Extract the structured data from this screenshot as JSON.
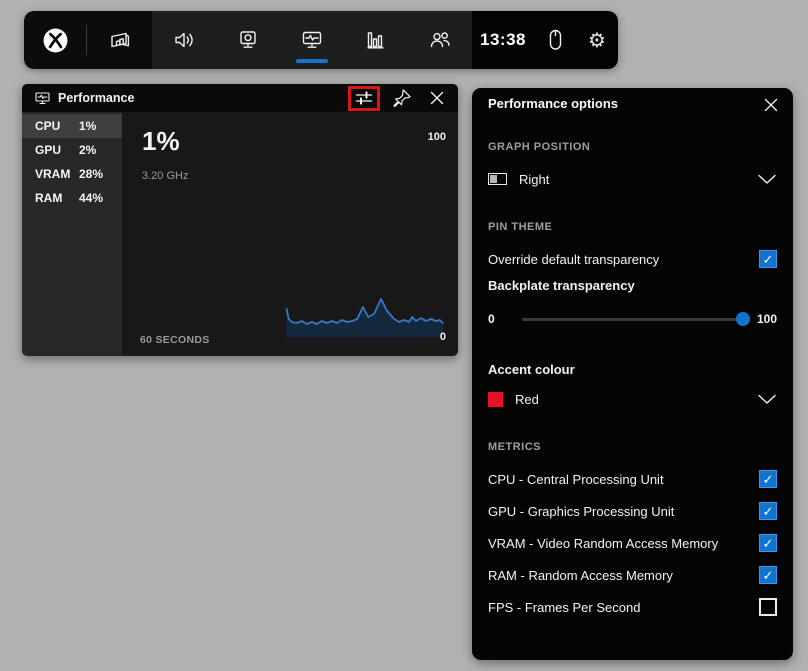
{
  "toolbar": {
    "time": "13:38",
    "active_tab": "performance",
    "icons": [
      "xbox-logo",
      "widget-menu",
      "audio",
      "capture",
      "performance",
      "resources",
      "social",
      "mouse",
      "settings"
    ]
  },
  "performance_widget": {
    "title": "Performance",
    "header_icons": [
      "performance-mini",
      "options-sliders",
      "pin",
      "close"
    ],
    "stats": [
      {
        "label": "CPU",
        "value": "1%",
        "selected": true
      },
      {
        "label": "GPU",
        "value": "2%",
        "selected": false
      },
      {
        "label": "VRAM",
        "value": "28%",
        "selected": false
      },
      {
        "label": "RAM",
        "value": "44%",
        "selected": false
      }
    ],
    "big_value": "1%",
    "clock_speed": "3.20 GHz",
    "axis_max": "100",
    "axis_min": "0",
    "time_window": "60 SECONDS",
    "chart_data": {
      "type": "line",
      "title": "CPU usage over last 60 seconds",
      "ylim": [
        0,
        100
      ],
      "x_window_label": "60 SECONDS",
      "series": [
        {
          "name": "CPU %",
          "points": [
            [
              0.49,
              14
            ],
            [
              0.496,
              9
            ],
            [
              0.505,
              7.5
            ],
            [
              0.52,
              7
            ],
            [
              0.535,
              8
            ],
            [
              0.55,
              6.5
            ],
            [
              0.565,
              7.5
            ],
            [
              0.58,
              6.5
            ],
            [
              0.595,
              8
            ],
            [
              0.61,
              7
            ],
            [
              0.625,
              8
            ],
            [
              0.64,
              7
            ],
            [
              0.655,
              8.5
            ],
            [
              0.67,
              7.5
            ],
            [
              0.685,
              8
            ],
            [
              0.7,
              9
            ],
            [
              0.717,
              15
            ],
            [
              0.733,
              10
            ],
            [
              0.75,
              11.5
            ],
            [
              0.771,
              19
            ],
            [
              0.789,
              13
            ],
            [
              0.81,
              9
            ],
            [
              0.825,
              7.5
            ],
            [
              0.84,
              8.5
            ],
            [
              0.855,
              7.5
            ],
            [
              0.863,
              10
            ],
            [
              0.875,
              8
            ],
            [
              0.89,
              9.5
            ],
            [
              0.905,
              8
            ],
            [
              0.92,
              9
            ],
            [
              0.935,
              8
            ],
            [
              0.945,
              8.5
            ],
            [
              0.955,
              7
            ]
          ]
        }
      ]
    }
  },
  "options_panel": {
    "title": "Performance options",
    "graph_position": {
      "heading": "GRAPH POSITION",
      "value": "Right"
    },
    "pin_theme": {
      "heading": "PIN THEME",
      "override_label": "Override default transparency",
      "override_checked": true,
      "backplate_label": "Backplate transparency",
      "slider": {
        "min_label": "0",
        "max_label": "100",
        "value": 100
      }
    },
    "accent": {
      "heading": "Accent colour",
      "value": "Red",
      "swatch_color": "#e81123"
    },
    "metrics": {
      "heading": "METRICS",
      "items": [
        {
          "label": "CPU - Central Processing Unit",
          "checked": true
        },
        {
          "label": "GPU - Graphics Processing Unit",
          "checked": true
        },
        {
          "label": "VRAM - Video Random Access Memory",
          "checked": true
        },
        {
          "label": "RAM - Random Access Memory",
          "checked": true
        },
        {
          "label": "FPS - Frames Per Second",
          "checked": false
        }
      ]
    }
  },
  "colors": {
    "accent_blue": "#1574c9",
    "checkbox_blue": "#1273cd",
    "graph_line": "#3a77c2",
    "graph_fill": "#12375e",
    "accent_red": "#e81123",
    "annotation_red": "#d81414"
  }
}
